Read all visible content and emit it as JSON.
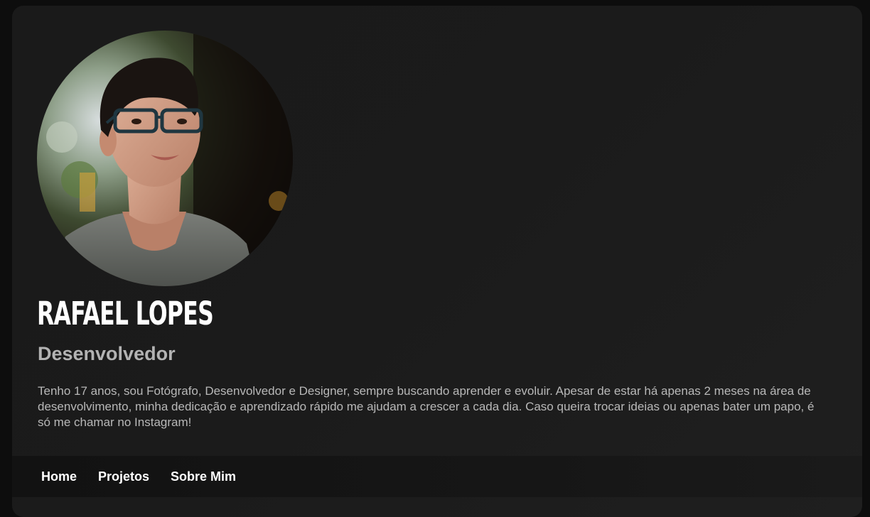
{
  "profile": {
    "name": "RAFAEL LOPES",
    "role": "Desenvolvedor",
    "bio": "Tenho 17 anos, sou Fotógrafo, Desenvolvedor e Designer, sempre buscando aprender e evoluir. Apesar de estar há apenas 2 meses na área de desenvolvimento, minha dedicação e aprendizado rápido me ajudam a crescer a cada dia. Caso queira trocar ideias ou apenas bater um papo, é só me chamar no Instagram!"
  },
  "nav": {
    "items": [
      {
        "label": "Home"
      },
      {
        "label": "Projetos"
      },
      {
        "label": "Sobre Mim"
      }
    ]
  },
  "colors": {
    "background": "#0d0d0d",
    "card": "#1b1b1b",
    "text_primary": "#ffffff",
    "text_secondary": "#b3b3b3"
  }
}
